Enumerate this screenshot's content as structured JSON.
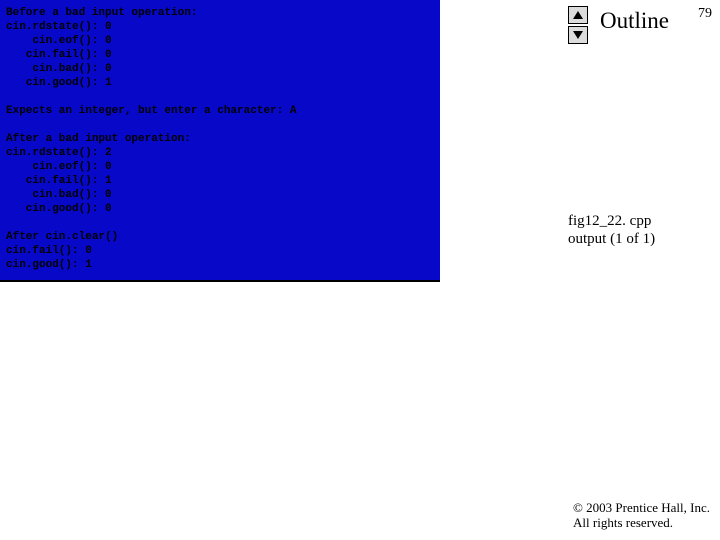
{
  "page_number": "79",
  "outline_label": "Outline",
  "nav": {
    "up_icon": "arrow-up",
    "down_icon": "arrow-down"
  },
  "figref": {
    "line1": "fig12_22. cpp",
    "line2": "output (1 of 1)"
  },
  "copyright": {
    "line1": "© 2003 Prentice Hall, Inc.",
    "line2": "All rights reserved."
  },
  "console": {
    "before_header": "Before a bad input operation:",
    "rows_before": [
      {
        "label": "cin.rdstate():",
        "value": "0"
      },
      {
        "label": "    cin.eof():",
        "value": "0"
      },
      {
        "label": "   cin.fail():",
        "value": "0"
      },
      {
        "label": "    cin.bad():",
        "value": "0"
      },
      {
        "label": "   cin.good():",
        "value": "1"
      }
    ],
    "prompt_line": "Expects an integer, but enter a character: A",
    "after_header": "After a bad input operation:",
    "rows_after": [
      {
        "label": "cin.rdstate():",
        "value": "2"
      },
      {
        "label": "    cin.eof():",
        "value": "0"
      },
      {
        "label": "   cin.fail():",
        "value": "1"
      },
      {
        "label": "    cin.bad():",
        "value": "0"
      },
      {
        "label": "   cin.good():",
        "value": "0"
      }
    ],
    "clear_header": "After cin.clear()",
    "rows_clear": [
      {
        "label": "cin.fail():",
        "value": "0"
      },
      {
        "label": "cin.good():",
        "value": "1"
      }
    ]
  }
}
